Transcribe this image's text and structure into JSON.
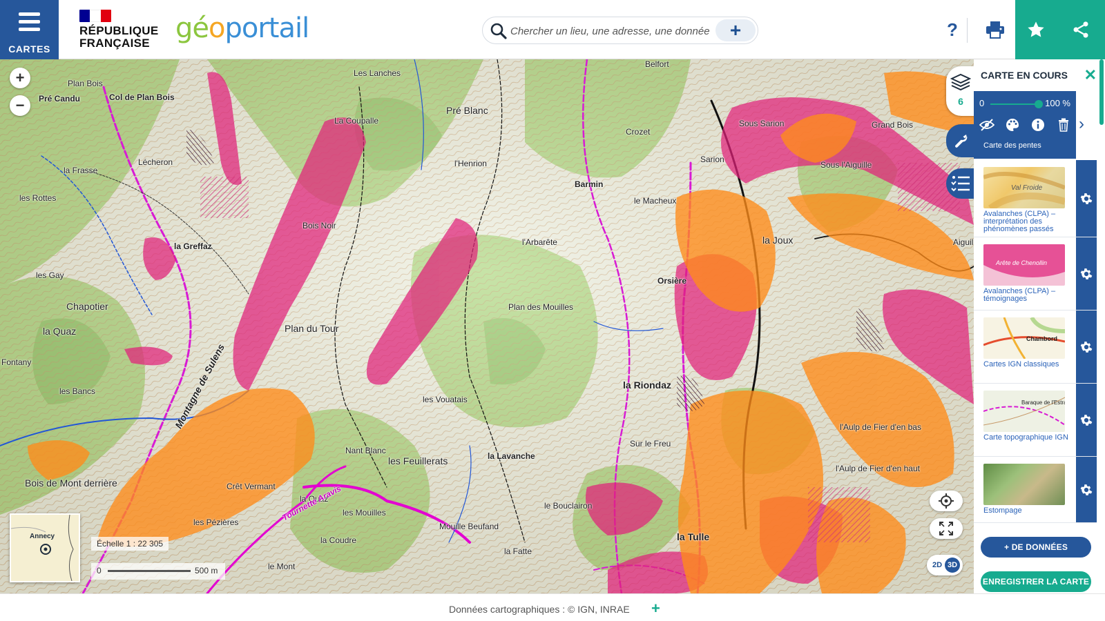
{
  "header": {
    "menu_label": "CARTES",
    "rf_line1": "RÉPUBLIQUE",
    "rf_line2": "FRANÇAISE",
    "brand_part1": "gé",
    "brand_part2": "o",
    "brand_part3": "portail",
    "help_label": "?",
    "flag_colors": [
      "#000091",
      "#ffffff",
      "#e1000f"
    ]
  },
  "search": {
    "placeholder": "Chercher un lieu, une adresse, une donnée",
    "plus_label": "+"
  },
  "map": {
    "zoom_in": "+",
    "zoom_out": "−",
    "scale_label": "Échelle 1 : 22 305",
    "scalebar_start": "0",
    "scalebar_end": "500 m",
    "minimap_label": "Annecy",
    "dim_2d": "2D",
    "dim_3d": "3D",
    "labels": [
      {
        "text": "Plan Bois",
        "cls": ""
      },
      {
        "text": "Col de Plan Bois",
        "cls": "bold"
      },
      {
        "text": "Pré Candu",
        "cls": "bold"
      },
      {
        "text": "Les Lanches",
        "cls": ""
      },
      {
        "text": "Pré Blanc",
        "cls": "big"
      },
      {
        "text": "Crozet",
        "cls": ""
      },
      {
        "text": "Sarion",
        "cls": ""
      },
      {
        "text": "Sous Sarion",
        "cls": ""
      },
      {
        "text": "Grand Bois",
        "cls": ""
      },
      {
        "text": "Sous l'Aiguille",
        "cls": ""
      },
      {
        "text": "La Coupalle",
        "cls": ""
      },
      {
        "text": "Lécheron",
        "cls": ""
      },
      {
        "text": "la Frasse",
        "cls": ""
      },
      {
        "text": "les Rottes",
        "cls": ""
      },
      {
        "text": "l'Henrion",
        "cls": ""
      },
      {
        "text": "Barmin",
        "cls": "bold"
      },
      {
        "text": "le Macheux",
        "cls": ""
      },
      {
        "text": "Bois Noir",
        "cls": ""
      },
      {
        "text": "la Greffaz",
        "cls": "bold"
      },
      {
        "text": "l'Arbarête",
        "cls": ""
      },
      {
        "text": "la Joux",
        "cls": "big"
      },
      {
        "text": "les Gay",
        "cls": ""
      },
      {
        "text": "Chapotier",
        "cls": "big"
      },
      {
        "text": "Orsière",
        "cls": "bold"
      },
      {
        "text": "Plan des Mouilles",
        "cls": ""
      },
      {
        "text": "Plan du Tour",
        "cls": "big"
      },
      {
        "text": "la Quaz",
        "cls": "big"
      },
      {
        "text": "Montagne de Sulens",
        "cls": "big bold italic"
      },
      {
        "text": "la Riondaz",
        "cls": "big bold"
      },
      {
        "text": "Fontany",
        "cls": ""
      },
      {
        "text": "les Bancs",
        "cls": ""
      },
      {
        "text": "les Vouatais",
        "cls": ""
      },
      {
        "text": "Sur le Freu",
        "cls": ""
      },
      {
        "text": "l'Aulp de Fier d'en bas",
        "cls": ""
      },
      {
        "text": "Nant Blanc",
        "cls": ""
      },
      {
        "text": "les Feuillerats",
        "cls": "big"
      },
      {
        "text": "la Lavanche",
        "cls": "bold"
      },
      {
        "text": "l'Aulp de Fier d'en haut",
        "cls": ""
      },
      {
        "text": "Bois de Mont derrière",
        "cls": "big"
      },
      {
        "text": "Crêt Vermant",
        "cls": ""
      },
      {
        "text": "la Quaz",
        "cls": ""
      },
      {
        "text": "les Mouilles",
        "cls": ""
      },
      {
        "text": "le Bouclairon",
        "cls": ""
      },
      {
        "text": "les Pézières",
        "cls": ""
      },
      {
        "text": "Mouille Beufand",
        "cls": ""
      },
      {
        "text": "la Coudre",
        "cls": ""
      },
      {
        "text": "la Fatte",
        "cls": ""
      },
      {
        "text": "la Tulle",
        "cls": "big bold"
      },
      {
        "text": "le Mont",
        "cls": ""
      },
      {
        "text": "Tournette Aravis",
        "cls": "bold italic"
      },
      {
        "text": "Belfort",
        "cls": ""
      },
      {
        "text": "Aiguil",
        "cls": ""
      }
    ]
  },
  "panel": {
    "title": "CARTE EN COURS",
    "close_label": "✕",
    "layer_count": "6",
    "opacity_min": "0",
    "opacity_max": "100 %",
    "opacity_value": 1.0,
    "active_layer_name": "Carte des pentes",
    "layers": [
      {
        "name": "Avalanches (CLPA) – interprétation des phénomènes passés",
        "thumb": "clpa-interp"
      },
      {
        "name": "Avalanches (CLPA) – témoignages",
        "thumb": "clpa-temoin"
      },
      {
        "name": "Cartes IGN classiques",
        "thumb": "ign-classic"
      },
      {
        "name": "Carte topographique IGN",
        "thumb": "ign-topo"
      },
      {
        "name": "Estompage",
        "thumb": "estompage"
      }
    ],
    "thumb_texts": {
      "clpa_interp": "Val Froide",
      "clpa_temoin": "Arête de Chenollin",
      "ign_classic": "Chambord",
      "ign_topo": "Baraque de l'Estrade"
    },
    "add_data_label": "+ DE DONNÉES",
    "save_map_label": "ENREGISTRER LA CARTE"
  },
  "footer": {
    "attribution": "Données cartographiques : © IGN,  INRAE",
    "plus_label": "+"
  },
  "colors": {
    "primary_blue": "#26579b",
    "teal": "#17ab8f",
    "avalanche_orange": "#ff8c1a",
    "avalanche_magenta": "#e0217a",
    "trail_magenta": "#d81bd4"
  }
}
